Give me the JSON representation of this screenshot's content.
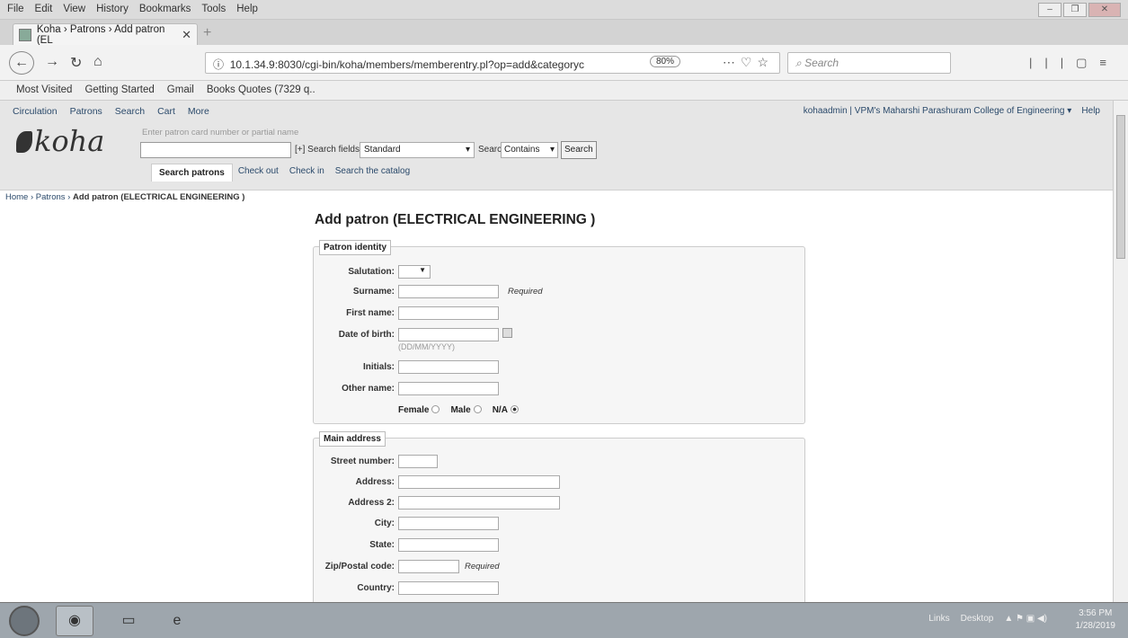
{
  "browser": {
    "menu": [
      "File",
      "Edit",
      "View",
      "History",
      "Bookmarks",
      "Tools",
      "Help"
    ],
    "tab_title": "Koha › Patrons › Add patron (EL",
    "url": "10.1.34.9:8030/cgi-bin/koha/members/memberentry.pl?op=add&categoryc",
    "zoom": "80%",
    "search_placeholder": "Search",
    "bookmarks": [
      "Most Visited",
      "Getting Started",
      "Gmail",
      "Books Quotes (7329 q.."
    ]
  },
  "koha": {
    "topnav": [
      "Circulation",
      "Patrons",
      "Search",
      "Cart",
      "More"
    ],
    "user": "kohaadmin",
    "library": "VPM's Maharshi Parashuram College of Engineering",
    "help": "Help",
    "logo": "koha",
    "search_hint": "Enter patron card number or partial name",
    "search_fields_label": "[+] Search fields:",
    "search_fields_value": "Standard",
    "search_type_label": "Search type:",
    "search_type_value": "Contains",
    "search_button": "Search",
    "tabs": [
      "Search patrons",
      "Check out",
      "Check in",
      "Search the catalog"
    ],
    "breadcrumb": [
      "Home",
      "Patrons",
      "Add patron (ELECTRICAL ENGINEERING )"
    ]
  },
  "form": {
    "title": "Add patron (ELECTRICAL ENGINEERING )",
    "identity": {
      "legend": "Patron identity",
      "salutation": "Salutation:",
      "surname": "Surname:",
      "first_name": "First name:",
      "dob": "Date of birth:",
      "dob_format": "(DD/MM/YYYY)",
      "initials": "Initials:",
      "other_name": "Other name:",
      "required": "Required",
      "gender_female": "Female",
      "gender_male": "Male",
      "gender_na": "N/A",
      "gender_selected": "N/A"
    },
    "address": {
      "legend": "Main address",
      "street_number": "Street number:",
      "address": "Address:",
      "address2": "Address 2:",
      "city": "City:",
      "state": "State:",
      "zip": "Zip/Postal code:",
      "country": "Country:",
      "required": "Required"
    }
  },
  "taskbar": {
    "links": "Links",
    "desktop": "Desktop",
    "time": "3:56 PM",
    "date": "1/28/2019"
  }
}
